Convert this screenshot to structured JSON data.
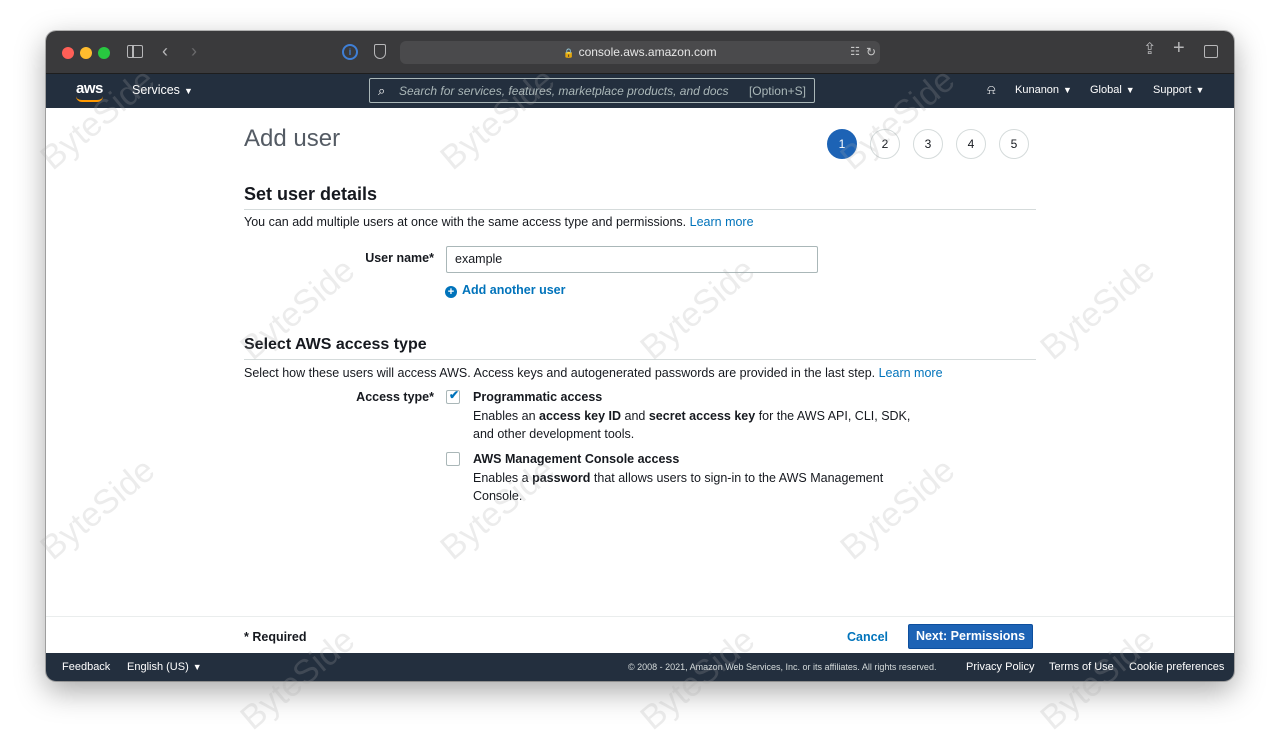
{
  "browser": {
    "url": "console.aws.amazon.com"
  },
  "nav": {
    "logo": "aws",
    "services": "Services",
    "search_placeholder": "Search for services, features, marketplace products, and docs",
    "search_shortcut": "[Option+S]",
    "user": "Kunanon",
    "region": "Global",
    "support": "Support"
  },
  "page": {
    "title": "Add user",
    "steps": [
      "1",
      "2",
      "3",
      "4",
      "5"
    ],
    "active_step": 1
  },
  "user_details": {
    "title": "Set user details",
    "description": "You can add multiple users at once with the same access type and permissions.",
    "learn_more": "Learn more",
    "username_label": "User name*",
    "username_value": "example",
    "add_another": "Add another user"
  },
  "access_type": {
    "title": "Select AWS access type",
    "description": "Select how these users will access AWS. Access keys and autogenerated passwords are provided in the last step.",
    "learn_more": "Learn more",
    "label": "Access type*",
    "programmatic": {
      "title": "Programmatic access",
      "checked": true,
      "desc_1": "Enables an ",
      "desc_b1": "access key ID",
      "desc_2": " and ",
      "desc_b2": "secret access key",
      "desc_3": " for the AWS API, CLI, SDK, and other development tools."
    },
    "console": {
      "title": "AWS Management Console access",
      "checked": false,
      "desc_1": "Enables a ",
      "desc_b1": "password",
      "desc_2": " that allows users to sign-in to the AWS Management Console."
    }
  },
  "actions": {
    "required": "* Required",
    "cancel": "Cancel",
    "next": "Next: Permissions"
  },
  "footer": {
    "feedback": "Feedback",
    "language": "English (US)",
    "copyright": "© 2008 - 2021, Amazon Web Services, Inc. or its affiliates. All rights reserved.",
    "privacy": "Privacy Policy",
    "terms": "Terms of Use",
    "cookies": "Cookie preferences"
  },
  "watermark": "ByteSide"
}
